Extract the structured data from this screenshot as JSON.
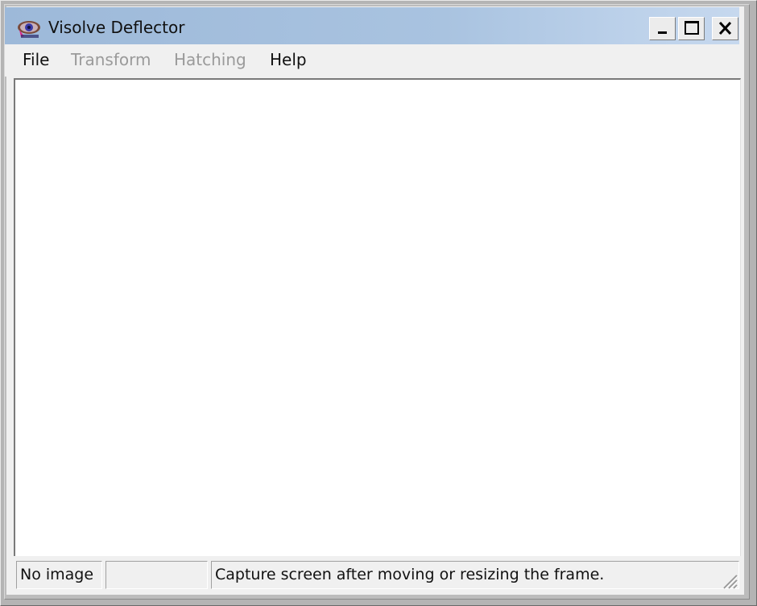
{
  "window": {
    "title": "Visolve Deflector",
    "app_icon": "visolve-eye-icon",
    "controls": {
      "minimize_icon": "minimize-icon",
      "maximize_icon": "maximize-icon",
      "close_icon": "close-icon"
    }
  },
  "menu": {
    "items": [
      {
        "label": "File",
        "enabled": true
      },
      {
        "label": "Transform",
        "enabled": false
      },
      {
        "label": "Hatching",
        "enabled": false
      },
      {
        "label": "Help",
        "enabled": true
      }
    ]
  },
  "statusbar": {
    "panes": [
      {
        "text": "No image"
      },
      {
        "text": ""
      },
      {
        "text": "Capture screen after moving or resizing the frame."
      }
    ],
    "grip_icon": "resize-grip-icon"
  },
  "colors": {
    "titlebar_start": "#9db9d9",
    "titlebar_end": "#c6d8ee",
    "menu_disabled": "#9a9a9a"
  }
}
